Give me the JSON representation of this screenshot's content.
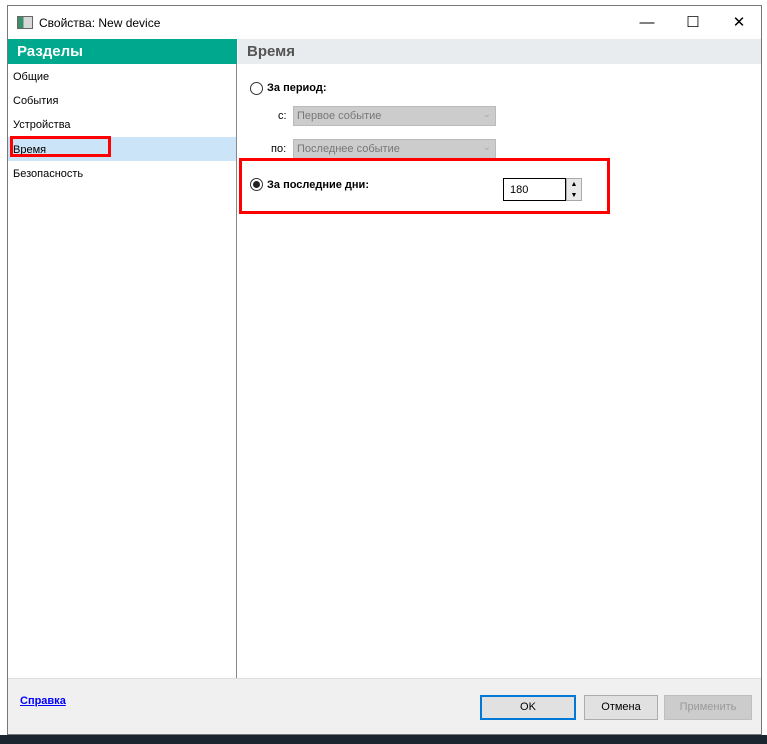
{
  "window": {
    "title": "Свойства: New device",
    "minimize": "—",
    "maximize": "☐",
    "close": "✕"
  },
  "sidebar": {
    "header": "Разделы",
    "items": [
      {
        "label": "Общие"
      },
      {
        "label": "События"
      },
      {
        "label": "Устройства"
      },
      {
        "label": "Время",
        "selected": true
      },
      {
        "label": "Безопасность"
      }
    ]
  },
  "main": {
    "header": "Время",
    "period": {
      "label": "За период:",
      "selected": false,
      "from_label": "с:",
      "from_value": "Первое событие",
      "to_label": "по:",
      "to_value": "Последнее событие"
    },
    "last_days": {
      "label": "За последние дни:",
      "selected": true,
      "value": "180"
    }
  },
  "footer": {
    "help": "Справка",
    "ok": "OK",
    "cancel": "Отмена",
    "apply": "Применить"
  },
  "colors": {
    "accent": "#00a88e",
    "highlight": "#ff0000",
    "selection": "#cce4f7"
  }
}
